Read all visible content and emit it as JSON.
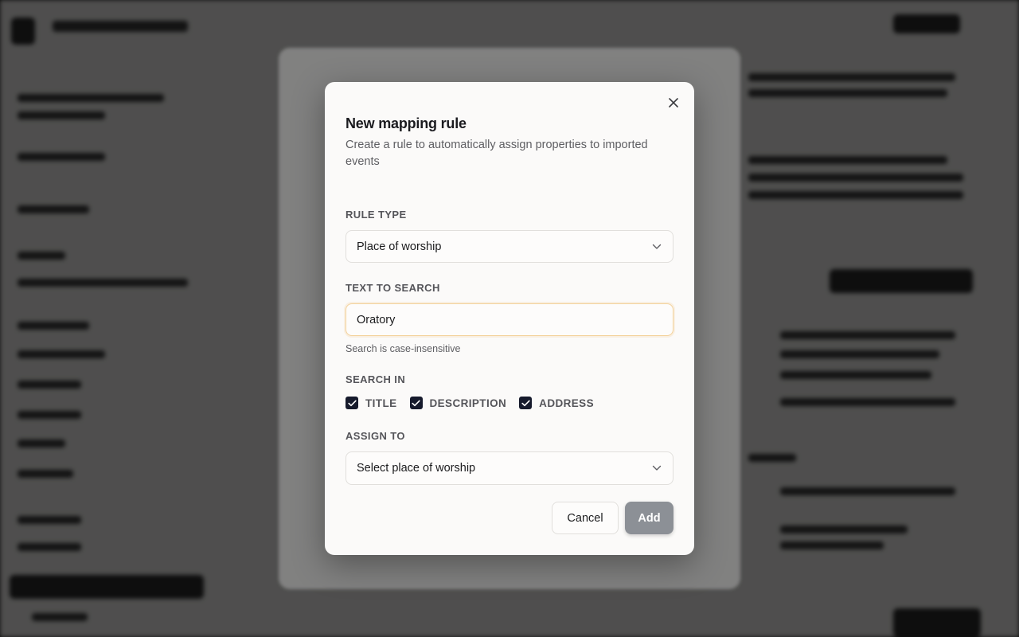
{
  "dialog": {
    "title": "New mapping rule",
    "subtitle": "Create a rule to automatically assign properties to imported events",
    "rule_type": {
      "label": "Rule type",
      "value": "Place of worship"
    },
    "text_to_search": {
      "label": "Text to search",
      "value": "Oratory",
      "hint": "Search is case-insensitive"
    },
    "search_in": {
      "label": "Search in",
      "options": [
        {
          "label": "Title",
          "checked": true
        },
        {
          "label": "Description",
          "checked": true
        },
        {
          "label": "Address",
          "checked": true
        }
      ]
    },
    "assign_to": {
      "label": "Assign to",
      "placeholder": "Select place of worship"
    },
    "cancel_label": "Cancel",
    "add_label": "Add"
  },
  "icons": {
    "close": "close-icon",
    "chevron": "chevron-down-icon",
    "check": "check-icon"
  },
  "colors": {
    "checkbox": "#161a2c",
    "focus_ring": "#f3d19a",
    "add_button": "#8c9096"
  }
}
